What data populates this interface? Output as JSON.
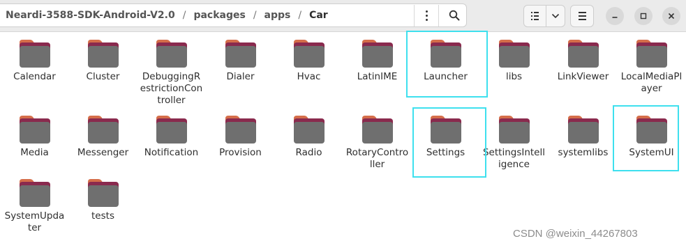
{
  "breadcrumb": [
    "Neardi-3588-SDK-Android-V2.0",
    "packages",
    "apps",
    "Car"
  ],
  "toolbar": {
    "more_icon": "kebab-menu-icon",
    "search_icon": "search-icon",
    "view_icon": "list-view-icon",
    "view_options_icon": "chevron-down-icon",
    "menu_icon": "hamburger-menu-icon"
  },
  "window_controls": [
    "minimize",
    "maximize",
    "close"
  ],
  "colors": {
    "folder_tab": "#d56e4a",
    "folder_back": "#8a2a4e",
    "folder_front": "#6f6f6f",
    "highlight": "#3ee0ee"
  },
  "folders": [
    "Calendar",
    "Cluster",
    "DebuggingRestrictionController",
    "Dialer",
    "Hvac",
    "LatinIME",
    "Launcher",
    "libs",
    "LinkViewer",
    "LocalMediaPlayer",
    "Media",
    "Messenger",
    "Notification",
    "Provision",
    "Radio",
    "RotaryController",
    "Settings",
    "SettingsIntelligence",
    "systemlibs",
    "SystemUI",
    "SystemUpdater",
    "tests"
  ],
  "highlighted": [
    "Launcher",
    "Settings",
    "SystemUI"
  ],
  "watermark": "CSDN @weixin_44267803"
}
